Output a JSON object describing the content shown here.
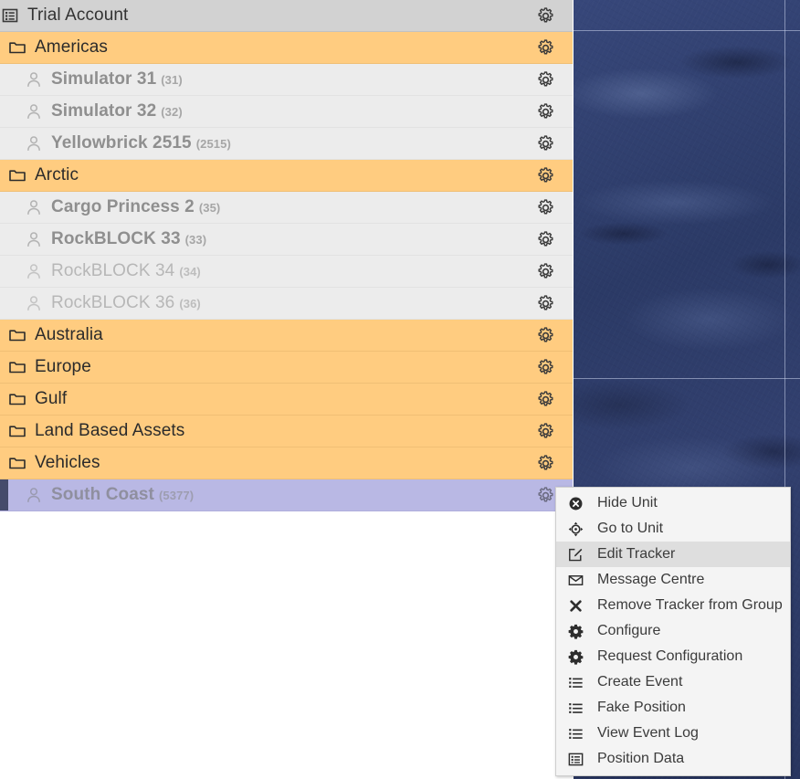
{
  "tree": {
    "account": {
      "label": "Trial Account",
      "icon": "list-box-icon"
    },
    "rows": [
      {
        "type": "group",
        "label": "Americas",
        "count": "",
        "icon": "folder-icon"
      },
      {
        "type": "tracker",
        "label": "Simulator 31",
        "count": "(31)",
        "icon": "person-icon",
        "state": "active"
      },
      {
        "type": "tracker",
        "label": "Simulator 32",
        "count": "(32)",
        "icon": "person-icon",
        "state": "active"
      },
      {
        "type": "tracker",
        "label": "Yellowbrick 2515",
        "count": "(2515)",
        "icon": "person-icon",
        "state": "active"
      },
      {
        "type": "group",
        "label": "Arctic",
        "count": "",
        "icon": "folder-icon"
      },
      {
        "type": "tracker",
        "label": "Cargo Princess 2",
        "count": "(35)",
        "icon": "person-icon",
        "state": "active"
      },
      {
        "type": "tracker",
        "label": "RockBLOCK 33",
        "count": "(33)",
        "icon": "person-icon",
        "state": "active"
      },
      {
        "type": "tracker",
        "label": "RockBLOCK 34",
        "count": "(34)",
        "icon": "person-icon",
        "state": "dim"
      },
      {
        "type": "tracker",
        "label": "RockBLOCK 36",
        "count": "(36)",
        "icon": "person-icon",
        "state": "dim"
      },
      {
        "type": "group",
        "label": "Australia",
        "count": "",
        "icon": "folder-icon"
      },
      {
        "type": "group",
        "label": "Europe",
        "count": "",
        "icon": "folder-icon"
      },
      {
        "type": "group",
        "label": "Gulf",
        "count": "",
        "icon": "folder-icon"
      },
      {
        "type": "group",
        "label": "Land Based Assets",
        "count": "",
        "icon": "folder-icon"
      },
      {
        "type": "group",
        "label": "Vehicles",
        "count": "",
        "icon": "folder-icon"
      },
      {
        "type": "selected",
        "label": "South Coast",
        "count": "(5377)",
        "icon": "person-icon"
      }
    ],
    "row_action_icon": "gear-icon",
    "colors": {
      "group_background": "#ffcc80",
      "account_background": "#d2d2d2",
      "tracker_background": "#ececec",
      "selected_background": "#b9b8e4",
      "selected_marker": "#454b6b"
    }
  },
  "context_menu": {
    "items": [
      {
        "label": "Hide Unit",
        "icon": "circle-x-icon",
        "highlighted": false
      },
      {
        "label": "Go to Unit",
        "icon": "crosshair-icon",
        "highlighted": false
      },
      {
        "label": "Edit Tracker",
        "icon": "edit-pencil-icon",
        "highlighted": true
      },
      {
        "label": "Message Centre",
        "icon": "envelope-icon",
        "highlighted": false
      },
      {
        "label": "Remove Tracker from Group",
        "icon": "x-mark-icon",
        "highlighted": false
      },
      {
        "label": "Configure",
        "icon": "gear-icon",
        "highlighted": false
      },
      {
        "label": "Request Configuration",
        "icon": "gear-icon",
        "highlighted": false
      },
      {
        "label": "Create Event",
        "icon": "list-icon",
        "highlighted": false
      },
      {
        "label": "Fake Position",
        "icon": "list-icon",
        "highlighted": false
      },
      {
        "label": "View Event Log",
        "icon": "list-icon",
        "highlighted": false
      },
      {
        "label": "Position Data",
        "icon": "list-box-icon",
        "highlighted": false
      }
    ]
  },
  "map": {
    "background_color": "#2d3d6b",
    "gridline_color": "#c8d2eb"
  }
}
